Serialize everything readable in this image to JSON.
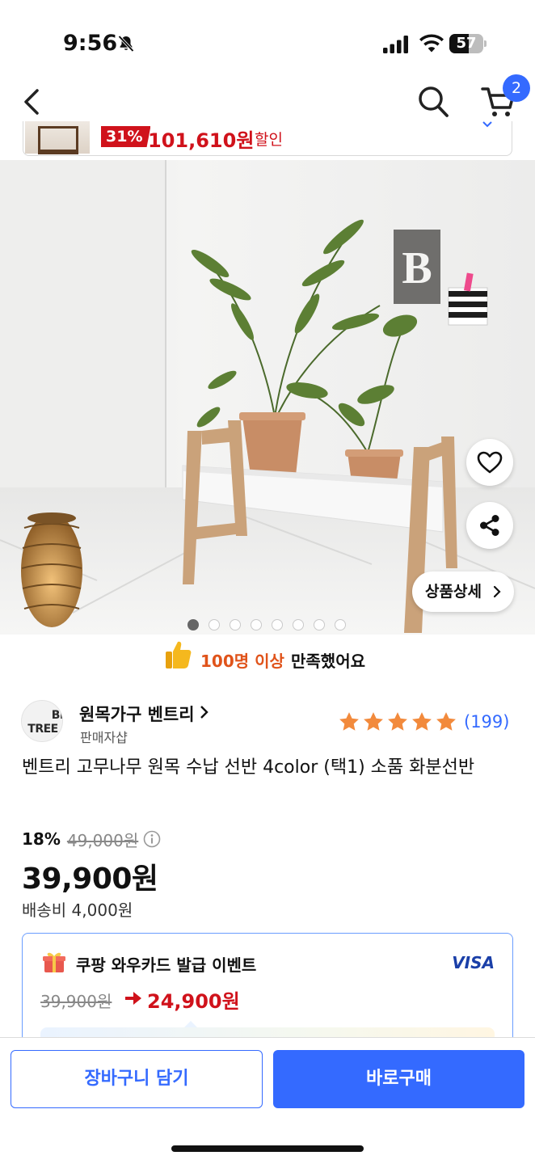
{
  "status_bar": {
    "time": "9:56",
    "battery_level": "57",
    "battery_fraction": 0.57
  },
  "nav": {
    "cart_count": "2"
  },
  "promo_strip": {
    "discount_tag": "31%",
    "price": "101,610원",
    "label": "할인"
  },
  "gallery": {
    "detail_button_label": "상품상세",
    "image_count": 8,
    "active_index": 0,
    "wall_letter": "B"
  },
  "satisfaction": {
    "highlight": "100명 이상",
    "rest": "만족했어요"
  },
  "seller": {
    "logo_line1_a": "BEN",
    "logo_line1_b": "",
    "logo_line2": "TREE",
    "name": "원목가구 벤트리",
    "subtitle": "판매자샵"
  },
  "rating": {
    "stars": 5,
    "review_count": "(199)"
  },
  "product": {
    "title": "벤트리 고무나무 원목 수납 선반 4color (택1) 소품 화분선반",
    "discount_rate": "18%",
    "original_price": "49,000원",
    "sale_price": "39,900원",
    "shipping": "배송비 4,000원"
  },
  "card_event": {
    "title": "쿠팡 와우카드 발급 이벤트",
    "card_brand": "VISA",
    "original_price": "39,900원",
    "event_price": "24,900원"
  },
  "bottom_bar": {
    "cart_label": "장바구니 담기",
    "buy_label": "바로구매"
  },
  "colors": {
    "accent": "#346aff",
    "sale_red": "#d0121b",
    "orange": "#e0531a",
    "star": "#f28a3c"
  },
  "icons": [
    "bell-muted-icon",
    "signal-icon",
    "wifi-icon",
    "back-icon",
    "search-icon",
    "cart-icon",
    "heart-icon",
    "share-icon",
    "thumbs-up-icon",
    "star-icon",
    "info-icon",
    "gift-icon",
    "arrow-right-icon"
  ]
}
